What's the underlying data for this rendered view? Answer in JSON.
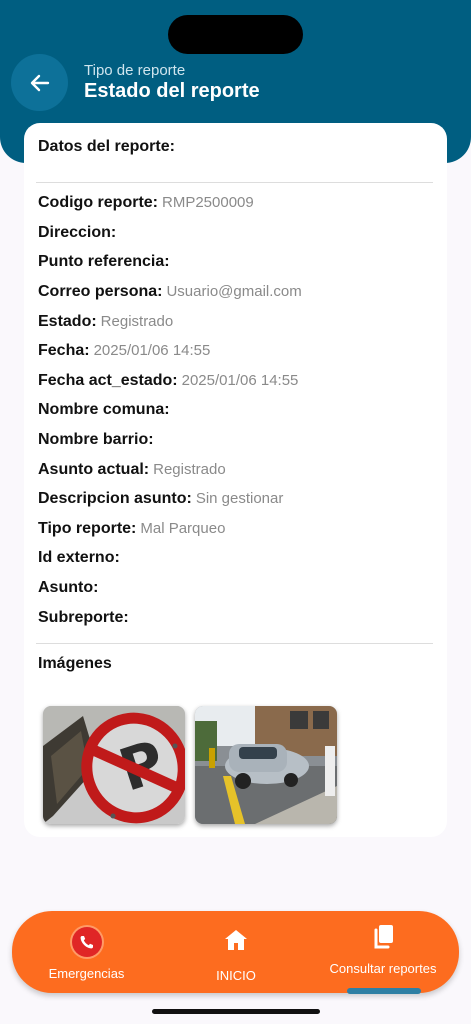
{
  "header": {
    "subtitle": "Tipo de reporte",
    "title": "Estado del reporte"
  },
  "card": {
    "title": "Datos del reporte:",
    "fields": [
      {
        "label": "Codigo reporte:",
        "value": "RMP2500009"
      },
      {
        "label": "Direccion:",
        "value": ""
      },
      {
        "label": "Punto referencia:",
        "value": ""
      },
      {
        "label": "Correo persona:",
        "value": "Usuario@gmail.com"
      },
      {
        "label": "Estado:",
        "value": "Registrado"
      },
      {
        "label": "Fecha:",
        "value": "2025/01/06 14:55"
      },
      {
        "label": "Fecha act_estado:",
        "value": "2025/01/06 14:55"
      },
      {
        "label": "Nombre comuna:",
        "value": ""
      },
      {
        "label": "Nombre barrio:",
        "value": ""
      },
      {
        "label": "Asunto actual:",
        "value": "Registrado"
      },
      {
        "label": "Descripcion asunto:",
        "value": "Sin gestionar"
      },
      {
        "label": "Tipo reporte:",
        "value": "Mal Parqueo"
      },
      {
        "label": "Id externo:",
        "value": ""
      },
      {
        "label": "Asunto:",
        "value": ""
      },
      {
        "label": "Subreporte:",
        "value": ""
      }
    ],
    "images_title": "Imágenes"
  },
  "nav": {
    "items": [
      {
        "label": "Emergencias",
        "icon": "phone-icon"
      },
      {
        "label": "INICIO",
        "icon": "home-icon"
      },
      {
        "label": "Consultar reportes",
        "icon": "copy-icon"
      }
    ]
  },
  "colors": {
    "header": "#005e81",
    "nav": "#fd6c1f",
    "accent": "#2e7fa4"
  }
}
